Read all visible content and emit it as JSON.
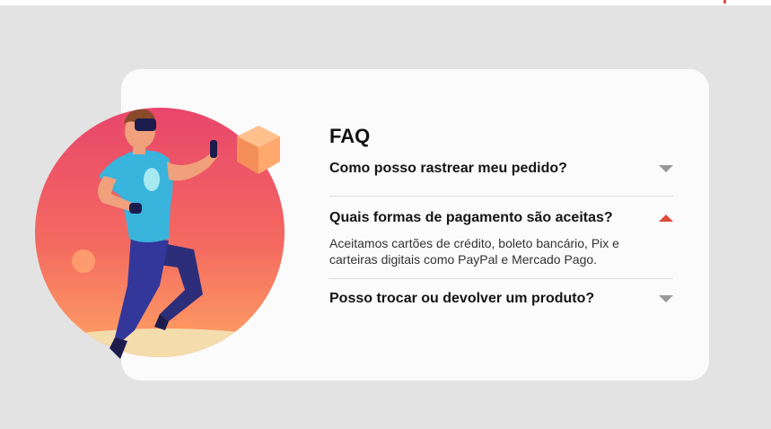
{
  "faq": {
    "title": "FAQ",
    "items": [
      {
        "question": "Como posso rastrear meu pedido?",
        "expanded": false,
        "icon": "chevron-down-icon"
      },
      {
        "question": "Quais formas de pagamento são aceitas?",
        "answer": "Aceitamos cartões de crédito, boleto bancário, Pix e carteiras digitais como PayPal e Mercado Pago.",
        "expanded": true,
        "icon": "chevron-up-icon"
      },
      {
        "question": "Posso trocar ou devolver um produto?",
        "expanded": false,
        "icon": "chevron-down-icon"
      }
    ]
  },
  "colors": {
    "background": "#e3e3e3",
    "card": "#fbfbfb",
    "accent": "#e0493b",
    "chevron_collapsed": "#999999",
    "circle_top": "#e8466b",
    "circle_bottom": "#ffa463"
  }
}
